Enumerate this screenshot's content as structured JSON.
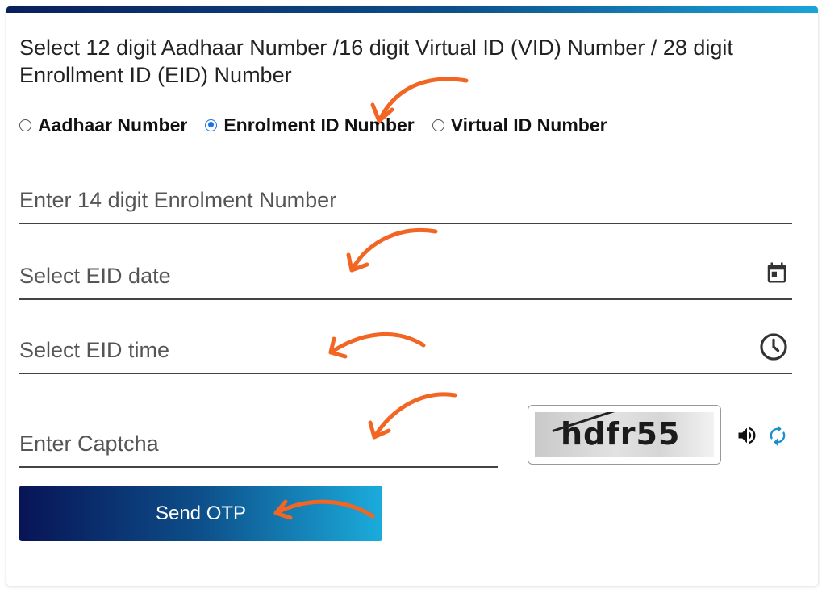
{
  "form": {
    "heading": "Select 12 digit Aadhaar Number /16 digit Virtual ID (VID) Number / 28 digit Enrollment ID (EID) Number",
    "radio_options": [
      {
        "label": "Aadhaar Number",
        "checked": false
      },
      {
        "label": "Enrolment ID Number",
        "checked": true
      },
      {
        "label": "Virtual ID Number",
        "checked": false
      }
    ],
    "enrolment_placeholder": "Enter 14 digit Enrolment Number",
    "eid_date_placeholder": "Select EID date",
    "eid_time_placeholder": "Select EID time",
    "captcha_placeholder": "Enter Captcha",
    "captcha_text": "hdfr55",
    "send_otp_label": "Send OTP"
  },
  "icons": {
    "date": "calendar-icon",
    "time": "clock-icon",
    "audio": "speaker-icon",
    "refresh": "refresh-icon"
  },
  "colors": {
    "accent_radio": "#1a73e8",
    "button_gradient_start": "#081456",
    "button_gradient_end": "#1bacdc",
    "annotation_arrow": "#f26522",
    "refresh_icon": "#1a8fd0"
  }
}
